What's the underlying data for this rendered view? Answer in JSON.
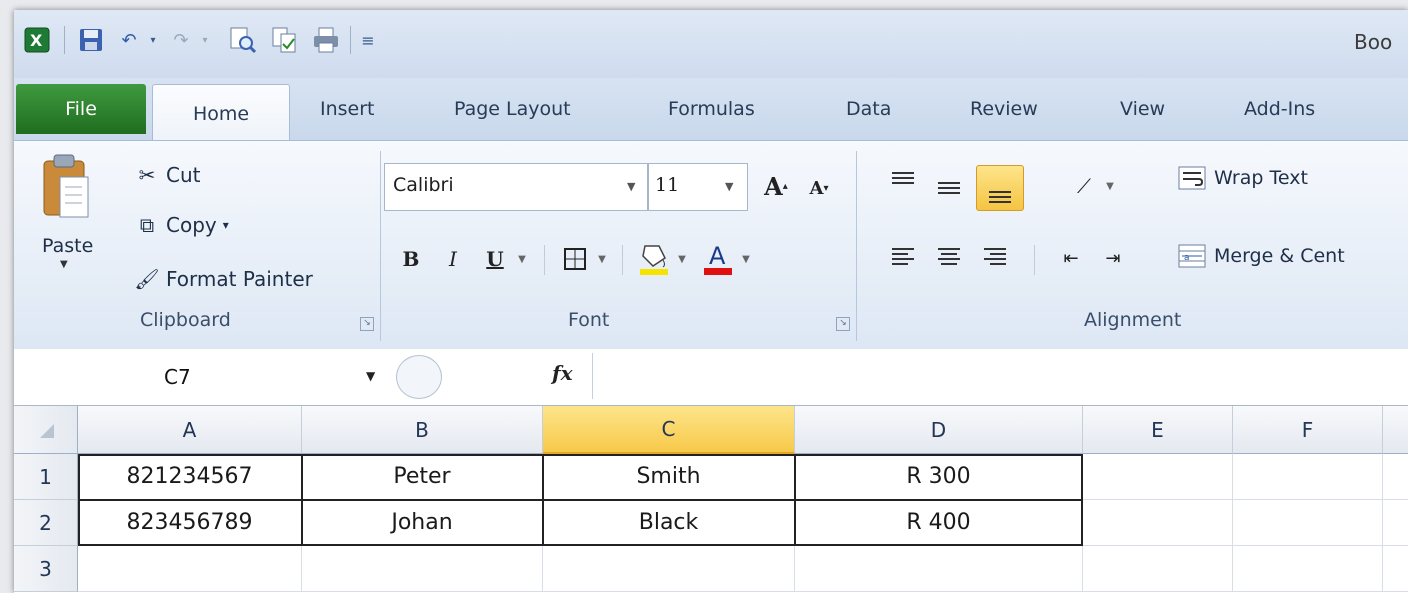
{
  "window": {
    "title": "Boo"
  },
  "quick_access": {
    "icons": [
      "excel-icon",
      "save-icon",
      "undo-icon",
      "undo-dropdown-icon",
      "redo-icon",
      "redo-dropdown-icon",
      "print-preview-icon",
      "spelling-icon",
      "print-icon",
      "customize-icon"
    ]
  },
  "tabs": [
    "File",
    "Home",
    "Insert",
    "Page Layout",
    "Formulas",
    "Data",
    "Review",
    "View",
    "Add-Ins"
  ],
  "clipboard": {
    "paste": "Paste",
    "cut": "Cut",
    "copy": "Copy",
    "copy_arrow": "▾",
    "format_painter": "Format Painter",
    "group": "Clipboard"
  },
  "font": {
    "name": "Calibri",
    "size": "11",
    "grow": "A",
    "shrink": "A",
    "bold": "B",
    "italic": "I",
    "underline": "U",
    "group": "Font"
  },
  "alignment": {
    "wrap_text": "Wrap Text",
    "merge": "Merge & Cent",
    "group": "Alignment"
  },
  "formula_bar": {
    "name_box": "C7",
    "fx": "fx",
    "formula": ""
  },
  "grid": {
    "columns": [
      "A",
      "B",
      "C",
      "D",
      "E",
      "F"
    ],
    "selected_column": "C",
    "rows": [
      "1",
      "2",
      "3"
    ],
    "cells": [
      [
        "821234567",
        "Peter",
        "Smith",
        "R 300",
        "",
        ""
      ],
      [
        "823456789",
        "Johan",
        "Black",
        "R 400",
        "",
        ""
      ],
      [
        "",
        "",
        "",
        "",
        "",
        ""
      ]
    ]
  },
  "colors": {
    "file_tab": "#2a7d2a",
    "selected_header": "#f7c94a",
    "font_color": "#e01010",
    "highlight_color": "#f4e400"
  }
}
